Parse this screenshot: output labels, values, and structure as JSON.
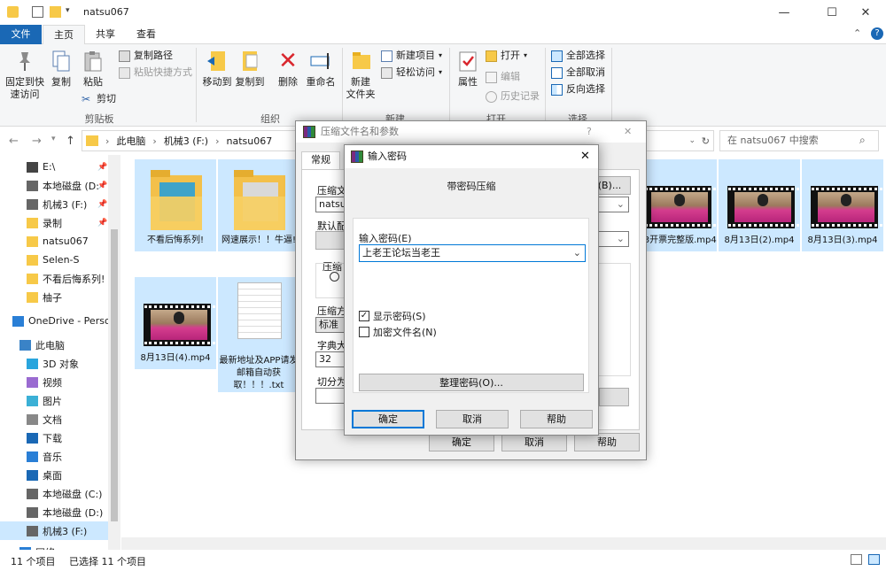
{
  "window": {
    "title": "natsu067",
    "min": "—",
    "max": "☐",
    "close": "✕",
    "expand": "⌃",
    "help": "?"
  },
  "ribbon_tabs": [
    "文件",
    "主页",
    "共享",
    "查看"
  ],
  "ribbon": {
    "pin_label_1": "固定到快",
    "pin_label_2": "速访问",
    "copy": "复制",
    "paste": "粘贴",
    "copy_path": "复制路径",
    "paste_shortcut": "粘贴快捷方式",
    "cut": "剪切",
    "clipboard_group": "剪贴板",
    "move_to": "移动到",
    "copy_to": "复制到",
    "delete": "删除",
    "rename": "重命名",
    "organize_group": "组织",
    "new_item": "新建项目",
    "easy_access": "轻松访问",
    "new_folder_1": "新建",
    "new_folder_2": "文件夹",
    "new_group": "新建",
    "properties": "属性",
    "open": "打开",
    "edit": "编辑",
    "history": "历史记录",
    "open_group": "打开",
    "select_all": "全部选择",
    "select_none": "全部取消",
    "invert_select": "反向选择",
    "select_group": "选择"
  },
  "address": {
    "parts": [
      "此电脑",
      "机械3 (F:)",
      "natsu067"
    ],
    "search_placeholder": "在 natsu067 中搜索"
  },
  "sidebar": {
    "items": [
      {
        "label": "E:\\",
        "pinned": true
      },
      {
        "label": "本地磁盘 (D:",
        "pinned": true
      },
      {
        "label": "机械3 (F:)",
        "pinned": true
      },
      {
        "label": "录制",
        "pinned": true
      },
      {
        "label": "natsu067"
      },
      {
        "label": "Selen-S"
      },
      {
        "label": "不看后悔系列!"
      },
      {
        "label": "柚子"
      },
      {
        "label": "OneDrive - Perso"
      },
      {
        "label": "此电脑"
      },
      {
        "label": "3D 对象"
      },
      {
        "label": "视频"
      },
      {
        "label": "图片"
      },
      {
        "label": "文档"
      },
      {
        "label": "下载"
      },
      {
        "label": "音乐"
      },
      {
        "label": "桌面"
      },
      {
        "label": "本地磁盘 (C:)"
      },
      {
        "label": "本地磁盘 (D:)"
      },
      {
        "label": "机械3 (F:)"
      },
      {
        "label": "网络"
      }
    ]
  },
  "files": [
    {
      "name": "不看后悔系列!",
      "type": "folder"
    },
    {
      "name": "网速展示！！牛逼!",
      "type": "folder"
    },
    {
      "name": ".13开票完整版.mp4",
      "type": "video"
    },
    {
      "name": "8月13日(2).mp4",
      "type": "video"
    },
    {
      "name": "8月13日(3).mp4",
      "type": "video"
    },
    {
      "name": "8月13日(4).mp4",
      "type": "video"
    },
    {
      "name": "最新地址及APP请发邮箱自动获取！！！.txt",
      "type": "text"
    }
  ],
  "status": {
    "count": "11 个项目",
    "selected": "已选择 11 个项目"
  },
  "dialog_archive": {
    "title": "压缩文件名和参数",
    "tab": "常规",
    "label_name": "压缩文",
    "name_value": "natsu0",
    "browse": "(B)...",
    "label_default": "默认配",
    "label_format": "压缩",
    "label_method": "压缩方",
    "method_value": "标准",
    "label_dict": "字典大",
    "dict_value": "32",
    "label_split": "切分为",
    "ok": "确定",
    "cancel": "取消",
    "help": "帮助"
  },
  "dialog_password": {
    "title": "输入密码",
    "heading": "带密码压缩",
    "label": "输入密码(E)",
    "password_value": "上老王论坛当老王",
    "show_password": "显示密码(S)",
    "encrypt_names": "加密文件名(N)",
    "organize": "整理密码(O)...",
    "ok": "确定",
    "cancel": "取消",
    "help": "帮助",
    "close": "✕"
  },
  "colors": {
    "accent": "#1a68b5",
    "selection": "#cce8ff"
  }
}
